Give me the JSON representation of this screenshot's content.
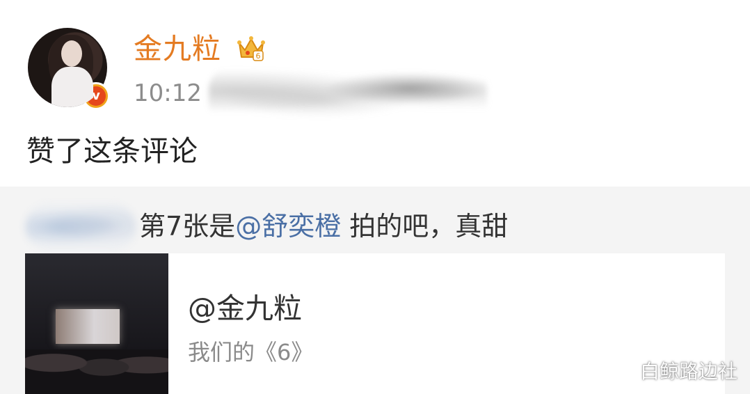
{
  "post": {
    "username": "金九粒",
    "time": "10:12",
    "action": "赞了这条评论",
    "avatar_icon": "avatar-image",
    "verified_icon": "verified-v-badge-icon",
    "member_icon": "crown-member-badge-icon",
    "verified_label": "v",
    "member_level": "6"
  },
  "comment": {
    "text_before": "第7张是",
    "mention": "@舒奕橙",
    "text_after": " 拍的吧，真甜"
  },
  "card": {
    "title": "@金九粒",
    "subtitle": "我们的《6》"
  },
  "watermark": "白鲸路边社",
  "colors": {
    "username": "#e47b22",
    "mention": "#4a6fa5",
    "comment_bg": "#f4f4f4"
  }
}
